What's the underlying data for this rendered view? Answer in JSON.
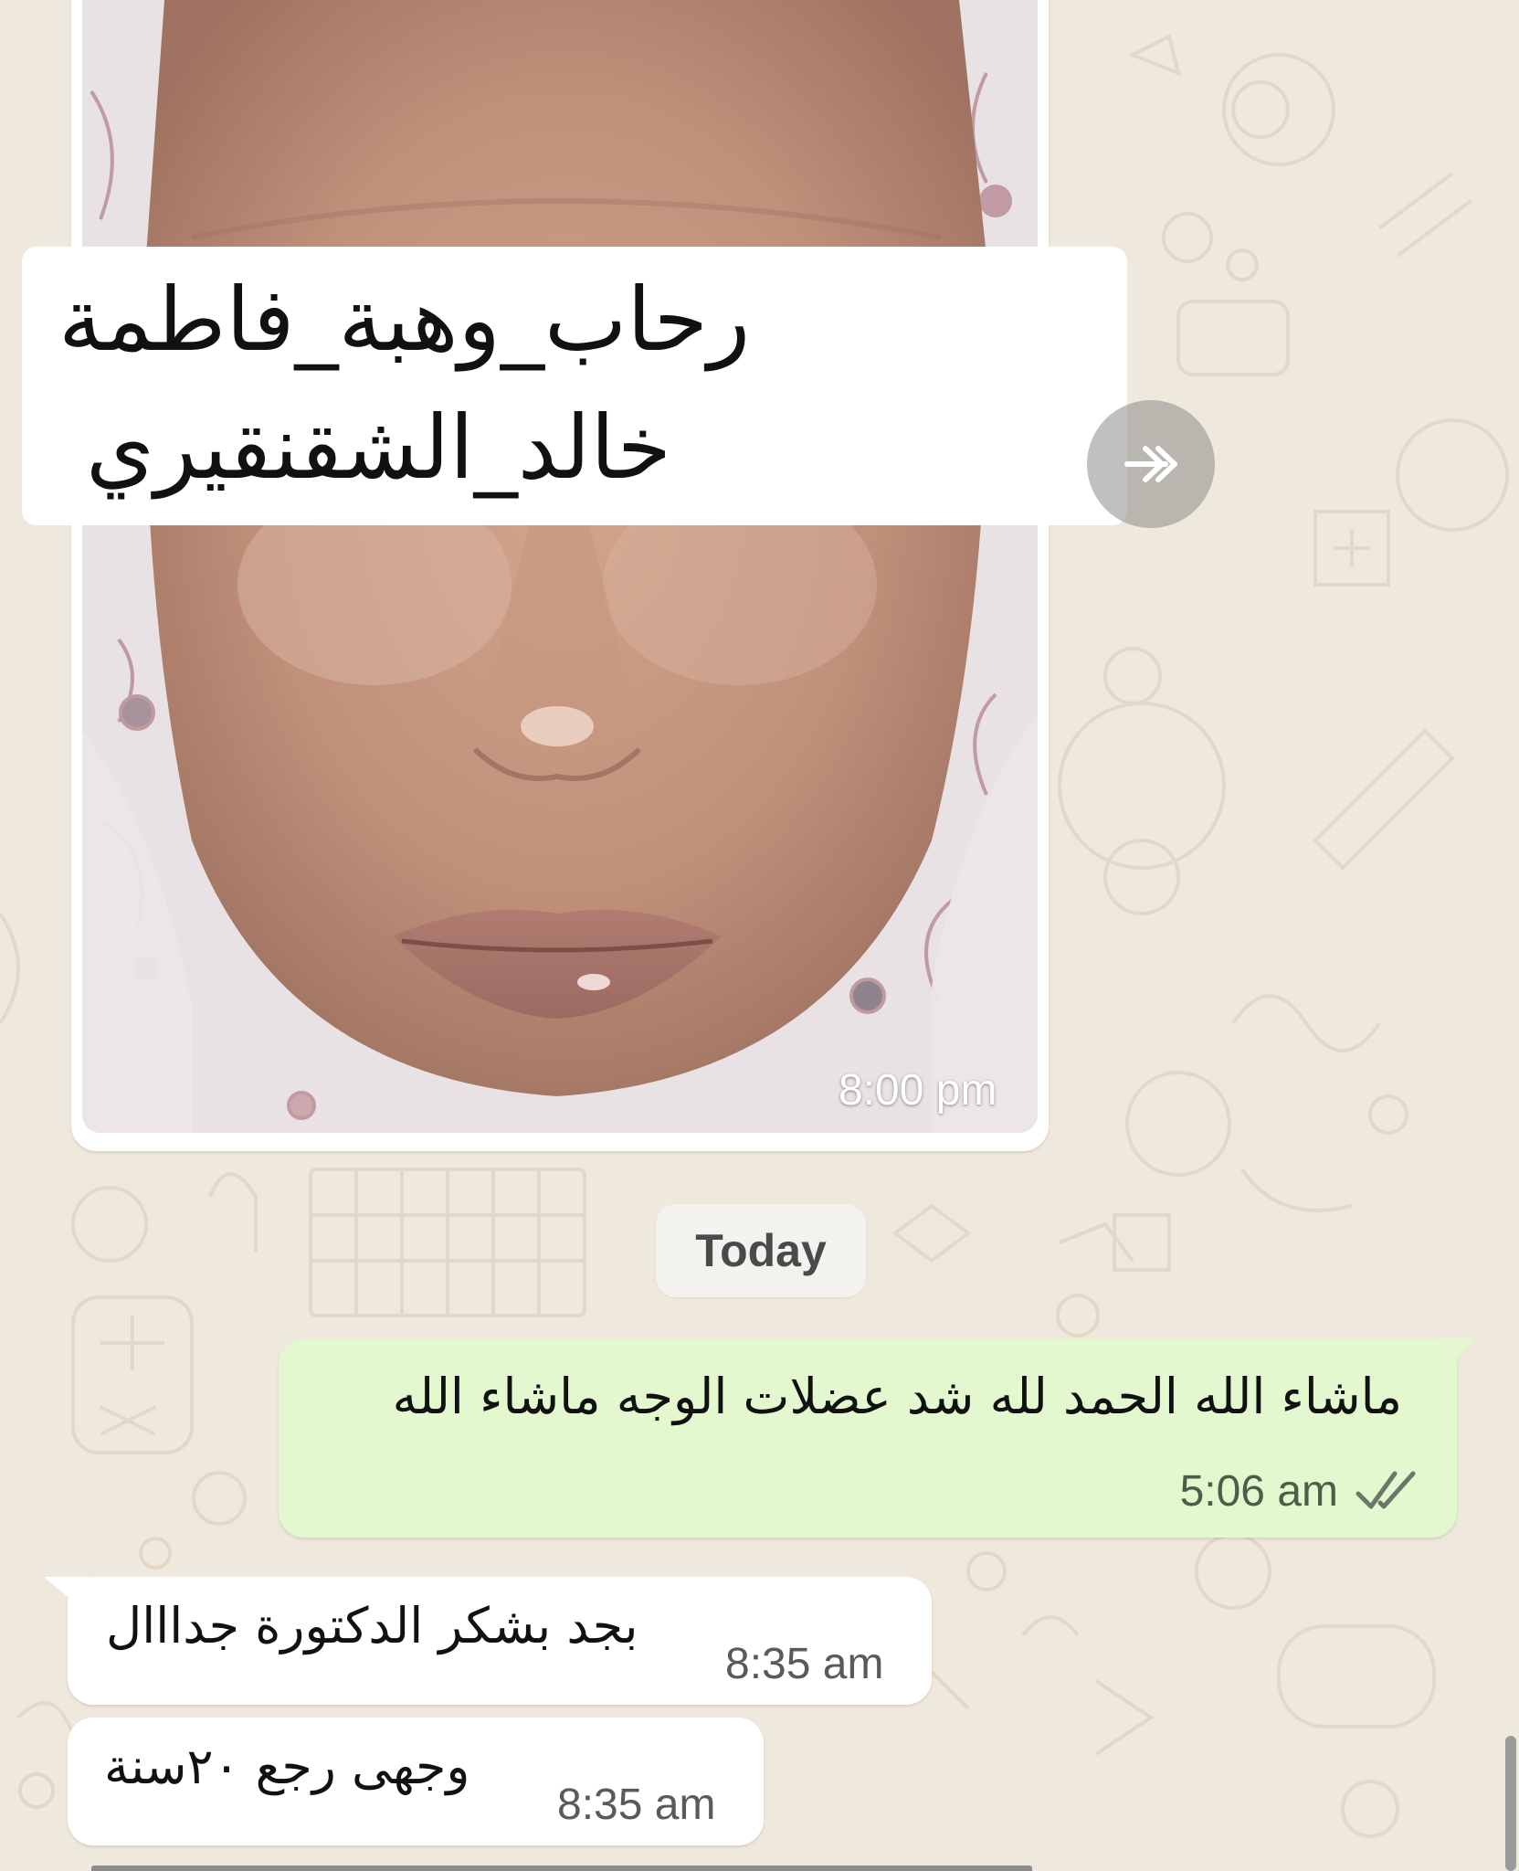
{
  "chat": {
    "photo_message": {
      "caption_lines": [
        "رحاب_وهبة_فاطمة",
        "خالد_الشقنقيري"
      ],
      "time": "8:00 pm",
      "forward_icon": "forward-icon"
    },
    "date_divider": "Today",
    "outgoing_message": {
      "text": "ماشاء الله الحمد لله شد عضلات الوجه ماشاء الله",
      "time": "5:06 am",
      "status_icon": "double-check-icon",
      "bubble_color": "#e3f8cf"
    },
    "incoming_messages": [
      {
        "text": "بجد بشكر الدكتورة جدااال",
        "time": "8:35 am"
      },
      {
        "text": "وجهى رجع ٢٠سنة",
        "time": "8:35 am"
      }
    ],
    "colors": {
      "wallpaper": "#efe8dc",
      "incoming_bubble": "#ffffff",
      "outgoing_bubble": "#e3f8cf"
    }
  }
}
